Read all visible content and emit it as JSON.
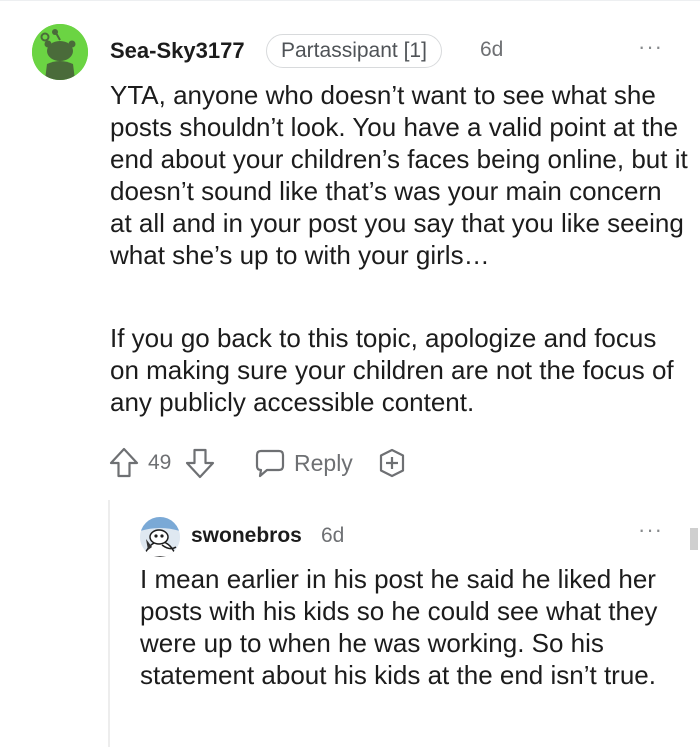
{
  "comment": {
    "username": "Sea-Sky3177",
    "flair": "Partassipant [1]",
    "time": "6d",
    "more_icon": "···",
    "paragraphs": [
      "YTA, anyone who doesn’t want to see what she posts shouldn’t look. You have a valid point at the end about your children’s faces being online, but it doesn’t sound like that’s was your main concern at all and in your post you say that you like seeing what she’s up to with your girls…",
      "If you go back to this topic, apologize and focus on making sure your children are not the focus of any publicly accessible content."
    ],
    "votes": "49",
    "reply_label": "Reply",
    "avatar_color": "#6bd443"
  },
  "reply": {
    "username": "swonebros",
    "time": "6d",
    "more_icon": "···",
    "text": "I mean earlier in his post he said he liked her posts with his kids so he could see what they were up to when he was working. So his statement about his kids at the end isn’t true."
  },
  "icons": {
    "upvote": "upvote-arrow-icon",
    "downvote": "downvote-arrow-icon",
    "reply": "speech-bubble-icon",
    "award": "award-plus-icon"
  }
}
